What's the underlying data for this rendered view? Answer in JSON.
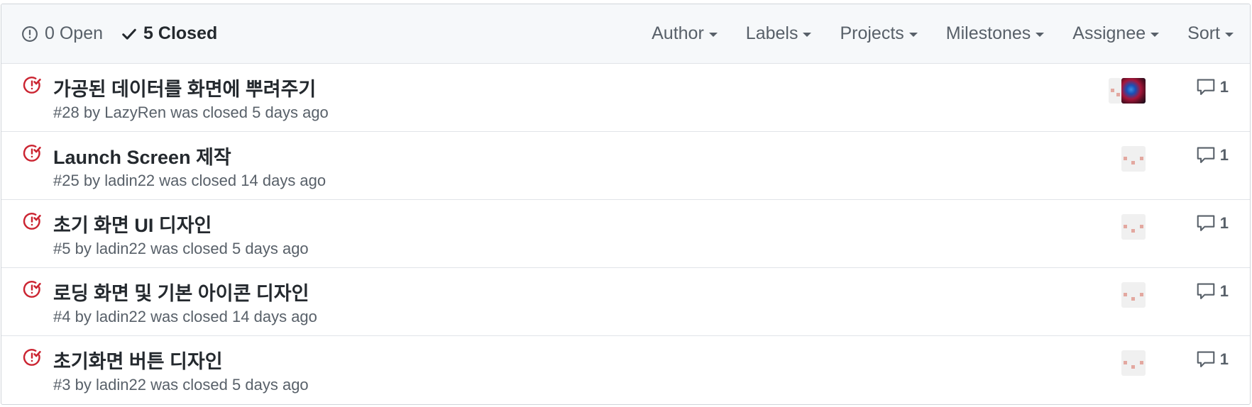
{
  "states": {
    "open_count": "0",
    "open_label": "Open",
    "closed_count": "5",
    "closed_label": "Closed"
  },
  "filters": [
    "Author",
    "Labels",
    "Projects",
    "Milestones",
    "Assignee",
    "Sort"
  ],
  "issues": [
    {
      "title": "가공된 데이터를 화면에 뿌려주기",
      "number": "#28",
      "by": "by",
      "author": "LazyRen",
      "status": "was closed",
      "when": "5 days ago",
      "comments": "1"
    },
    {
      "title": "Launch Screen 제작",
      "number": "#25",
      "by": "by",
      "author": "ladin22",
      "status": "was closed",
      "when": "14 days ago",
      "comments": "1"
    },
    {
      "title": "초기 화면 UI 디자인",
      "number": "#5",
      "by": "by",
      "author": "ladin22",
      "status": "was closed",
      "when": "5 days ago",
      "comments": "1"
    },
    {
      "title": "로딩 화면 및 기본 아이콘 디자인",
      "number": "#4",
      "by": "by",
      "author": "ladin22",
      "status": "was closed",
      "when": "14 days ago",
      "comments": "1"
    },
    {
      "title": "초기화면 버튼 디자인",
      "number": "#3",
      "by": "by",
      "author": "ladin22",
      "status": "was closed",
      "when": "5 days ago",
      "comments": "1"
    }
  ],
  "colors": {
    "closed_icon": "#cb2431",
    "text_primary": "#24292e",
    "text_muted": "#586069",
    "header_bg": "#f6f8fa"
  },
  "icons": {
    "open": "issue-opened-icon",
    "closed_tab": "check-icon",
    "issue_state": "issue-closed-icon",
    "comment": "comment-icon",
    "caret": "triangle-down-icon"
  }
}
